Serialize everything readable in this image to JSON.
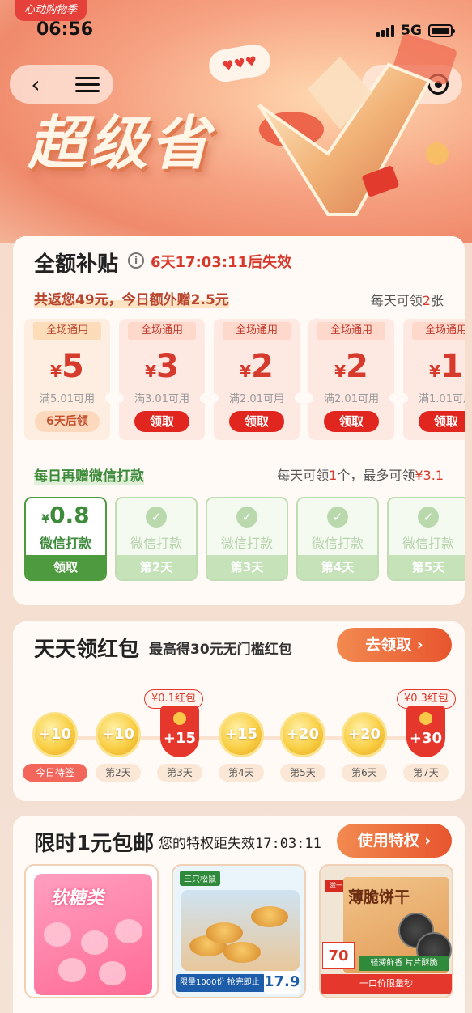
{
  "header": {
    "brand_tag": "心动购物季",
    "time": "06:56",
    "network": "5G",
    "hero_title": "超级省"
  },
  "subsidy": {
    "title": "全额补贴",
    "countdown": "6天17:03:11后失效",
    "summary": "共返您49元，今日额外赠2.5元",
    "daily_prefix": "每天可领",
    "daily_count": "2",
    "daily_suffix": "张",
    "coupons": [
      {
        "tag": "全场通用",
        "currency": "¥",
        "amount": "5",
        "condition": "满5.01可用",
        "action": "6天后领"
      },
      {
        "tag": "全场通用",
        "currency": "¥",
        "amount": "3",
        "condition": "满3.01可用",
        "action": "领取"
      },
      {
        "tag": "全场通用",
        "currency": "¥",
        "amount": "2",
        "condition": "满2.01可用",
        "action": "领取"
      },
      {
        "tag": "全场通用",
        "currency": "¥",
        "amount": "2",
        "condition": "满2.01可用",
        "action": "领取"
      },
      {
        "tag": "全场通用",
        "currency": "¥",
        "amount": "1",
        "condition": "满1.01可用",
        "action": "领取"
      }
    ],
    "wechat_title": "每日再赠微信打款",
    "wechat_rule_a": "每天可领",
    "wechat_rule_count": "1",
    "wechat_rule_b": "个，最多可领",
    "wechat_rule_max": "¥3.1",
    "wechat_items": [
      {
        "currency": "¥",
        "value": "0.8",
        "label": "微信打款",
        "footer": "领取"
      },
      {
        "label": "微信打款",
        "footer": "第2天"
      },
      {
        "label": "微信打款",
        "footer": "第3天"
      },
      {
        "label": "微信打款",
        "footer": "第4天"
      },
      {
        "label": "微信打款",
        "footer": "第5天"
      }
    ]
  },
  "redpacket": {
    "title": "天天领红包",
    "subtitle": "最高得30元无门槛红包",
    "button": "去领取 ›",
    "days": [
      {
        "value": "+10",
        "label": "今日待签"
      },
      {
        "value": "+10",
        "label": "第2天"
      },
      {
        "value": "+15",
        "label": "第3天",
        "bonus": "¥0.1红包"
      },
      {
        "value": "+15",
        "label": "第4天"
      },
      {
        "value": "+20",
        "label": "第5天"
      },
      {
        "value": "+20",
        "label": "第6天"
      },
      {
        "value": "+30",
        "label": "第7天",
        "bonus": "¥0.3红包"
      }
    ]
  },
  "limited": {
    "title": "限时1元包邮",
    "privilege_text": "您的特权距失效",
    "privilege_time": "17:03:11",
    "button": "使用特权 ›",
    "products": [
      {
        "name_text": "软糖类"
      },
      {
        "brand": "三只松鼠",
        "limit_text": "限量1000份 抢完即止",
        "price": "17.9"
      },
      {
        "brand": "滋一",
        "name_text": "薄脆饼干",
        "price": "70",
        "strip": "一口价限量秒",
        "strip2": "轻薄鲜香 片片酥脆"
      }
    ]
  }
}
